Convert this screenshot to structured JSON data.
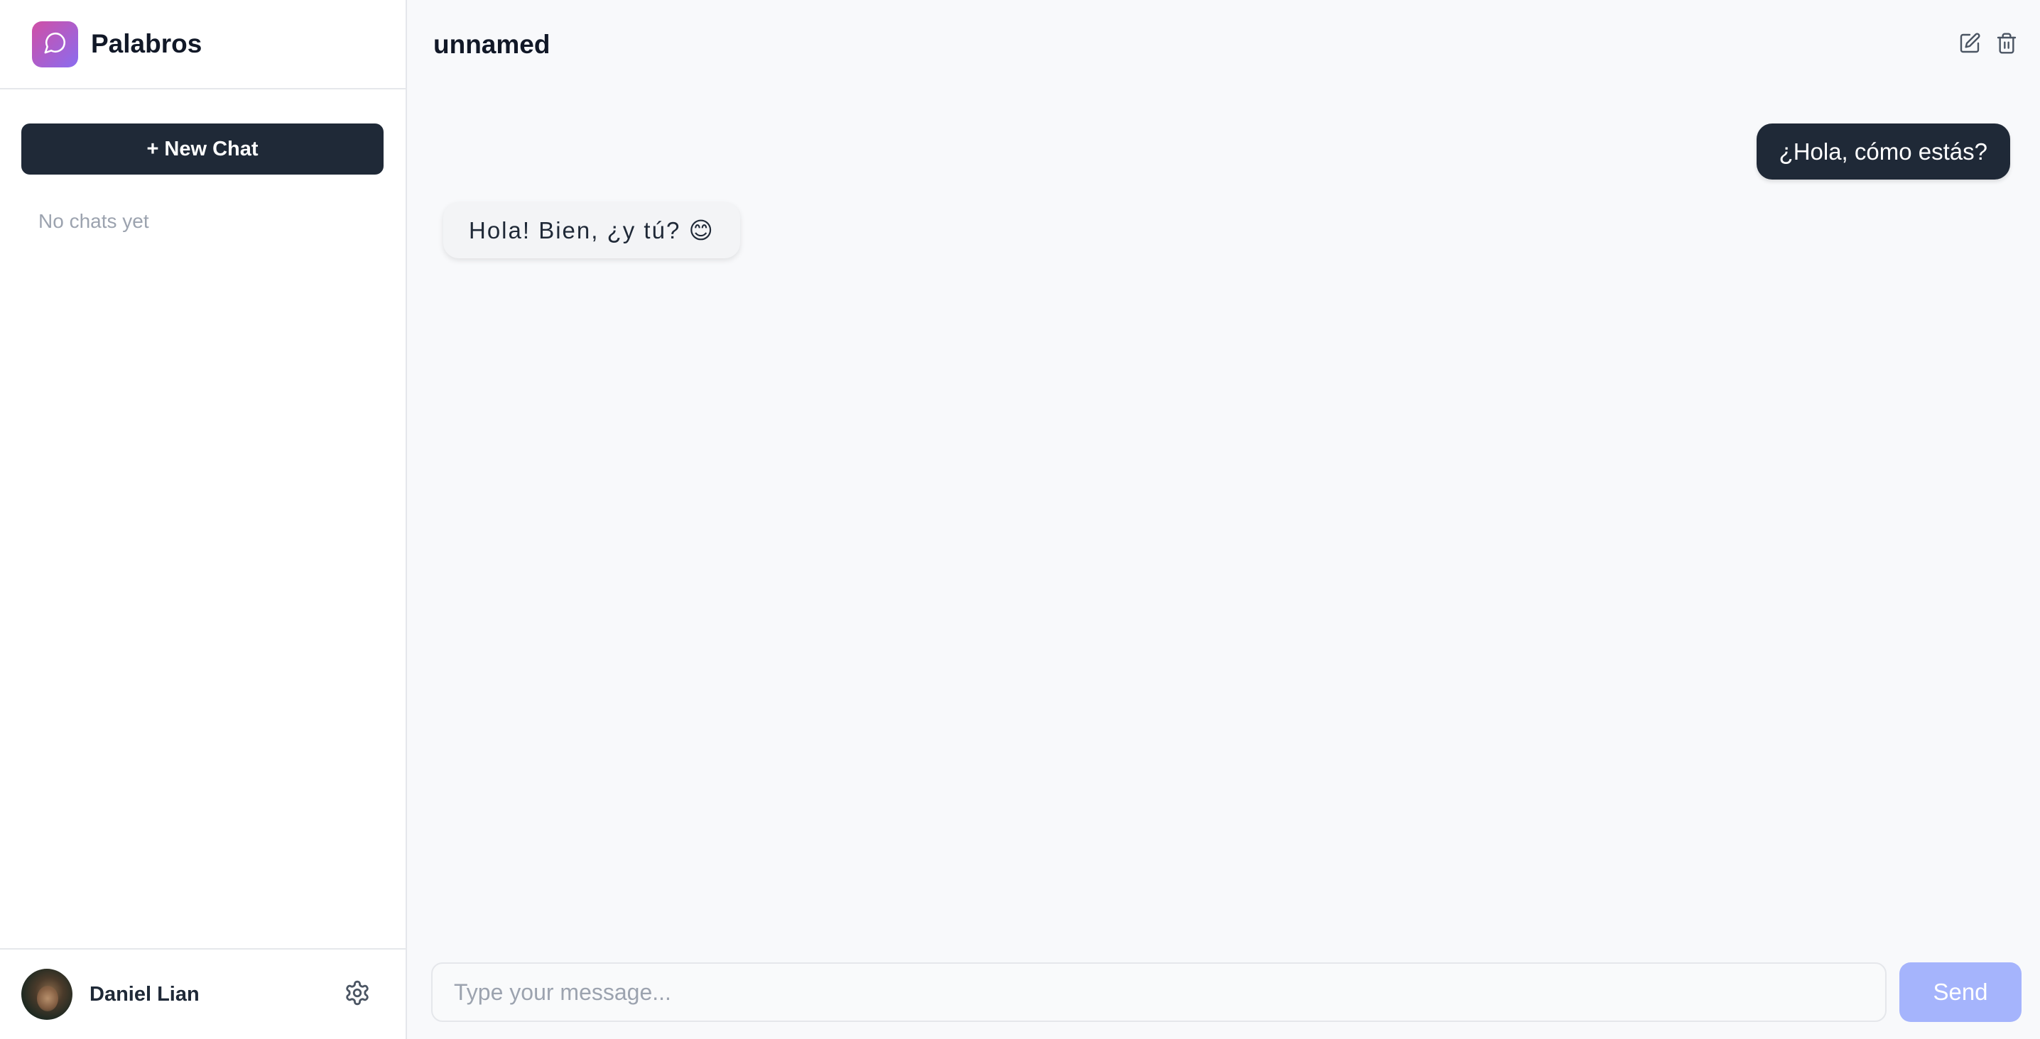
{
  "app": {
    "name": "Palabros",
    "logo_icon": "chat-bubble-icon",
    "brand_gradient": [
      "#d04fa5",
      "#8a6cf0"
    ]
  },
  "sidebar": {
    "new_chat_label": "+ New Chat",
    "empty_text": "No chats yet"
  },
  "user": {
    "name": "Daniel Lian",
    "settings_icon": "gear-icon"
  },
  "chat": {
    "title": "unnamed",
    "actions": [
      {
        "name": "edit",
        "icon": "edit-icon"
      },
      {
        "name": "delete",
        "icon": "trash-icon"
      }
    ],
    "messages": [
      {
        "role": "user",
        "text": "¿Hola, cómo estás?"
      },
      {
        "role": "assistant",
        "text": "Hola! Bien, ¿y tú? 😊"
      }
    ]
  },
  "composer": {
    "placeholder": "Type your message...",
    "value": "",
    "send_label": "Send",
    "send_color": "#a5b4fc"
  },
  "colors": {
    "dark": "#1f2937",
    "muted": "#9ca3af",
    "background": "#f8f9fb"
  }
}
